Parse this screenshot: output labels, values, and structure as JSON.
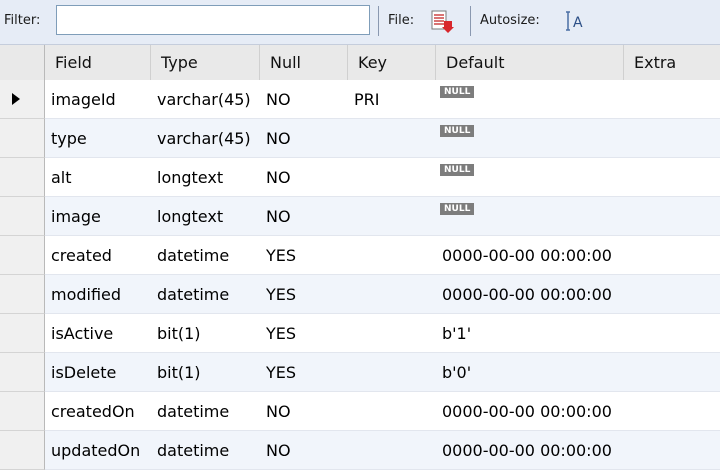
{
  "toolbar": {
    "filter_label": "Filter:",
    "filter_value": "",
    "file_label": "File:",
    "file_icon": "file-export-icon",
    "autosize_label": "Autosize:",
    "autosize_icon": "autosize-icon"
  },
  "table": {
    "columns": [
      "Field",
      "Type",
      "Null",
      "Key",
      "Default",
      "Extra"
    ],
    "null_badge": "NULL",
    "rows": [
      {
        "field": "imageId",
        "type": "varchar(45)",
        "null": "NO",
        "key": "PRI",
        "default": null,
        "extra": ""
      },
      {
        "field": "type",
        "type": "varchar(45)",
        "null": "NO",
        "key": "",
        "default": null,
        "extra": ""
      },
      {
        "field": "alt",
        "type": "longtext",
        "null": "NO",
        "key": "",
        "default": null,
        "extra": ""
      },
      {
        "field": "image",
        "type": "longtext",
        "null": "NO",
        "key": "",
        "default": null,
        "extra": ""
      },
      {
        "field": "created",
        "type": "datetime",
        "null": "YES",
        "key": "",
        "default": "0000-00-00 00:00:00",
        "extra": ""
      },
      {
        "field": "modified",
        "type": "datetime",
        "null": "YES",
        "key": "",
        "default": "0000-00-00 00:00:00",
        "extra": ""
      },
      {
        "field": "isActive",
        "type": "bit(1)",
        "null": "YES",
        "key": "",
        "default": "b'1'",
        "extra": ""
      },
      {
        "field": "isDelete",
        "type": "bit(1)",
        "null": "YES",
        "key": "",
        "default": "b'0'",
        "extra": ""
      },
      {
        "field": "createdOn",
        "type": "datetime",
        "null": "NO",
        "key": "",
        "default": "0000-00-00 00:00:00",
        "extra": ""
      },
      {
        "field": "updatedOn",
        "type": "datetime",
        "null": "NO",
        "key": "",
        "default": "0000-00-00 00:00:00",
        "extra": ""
      }
    ],
    "selected_row": 0
  }
}
